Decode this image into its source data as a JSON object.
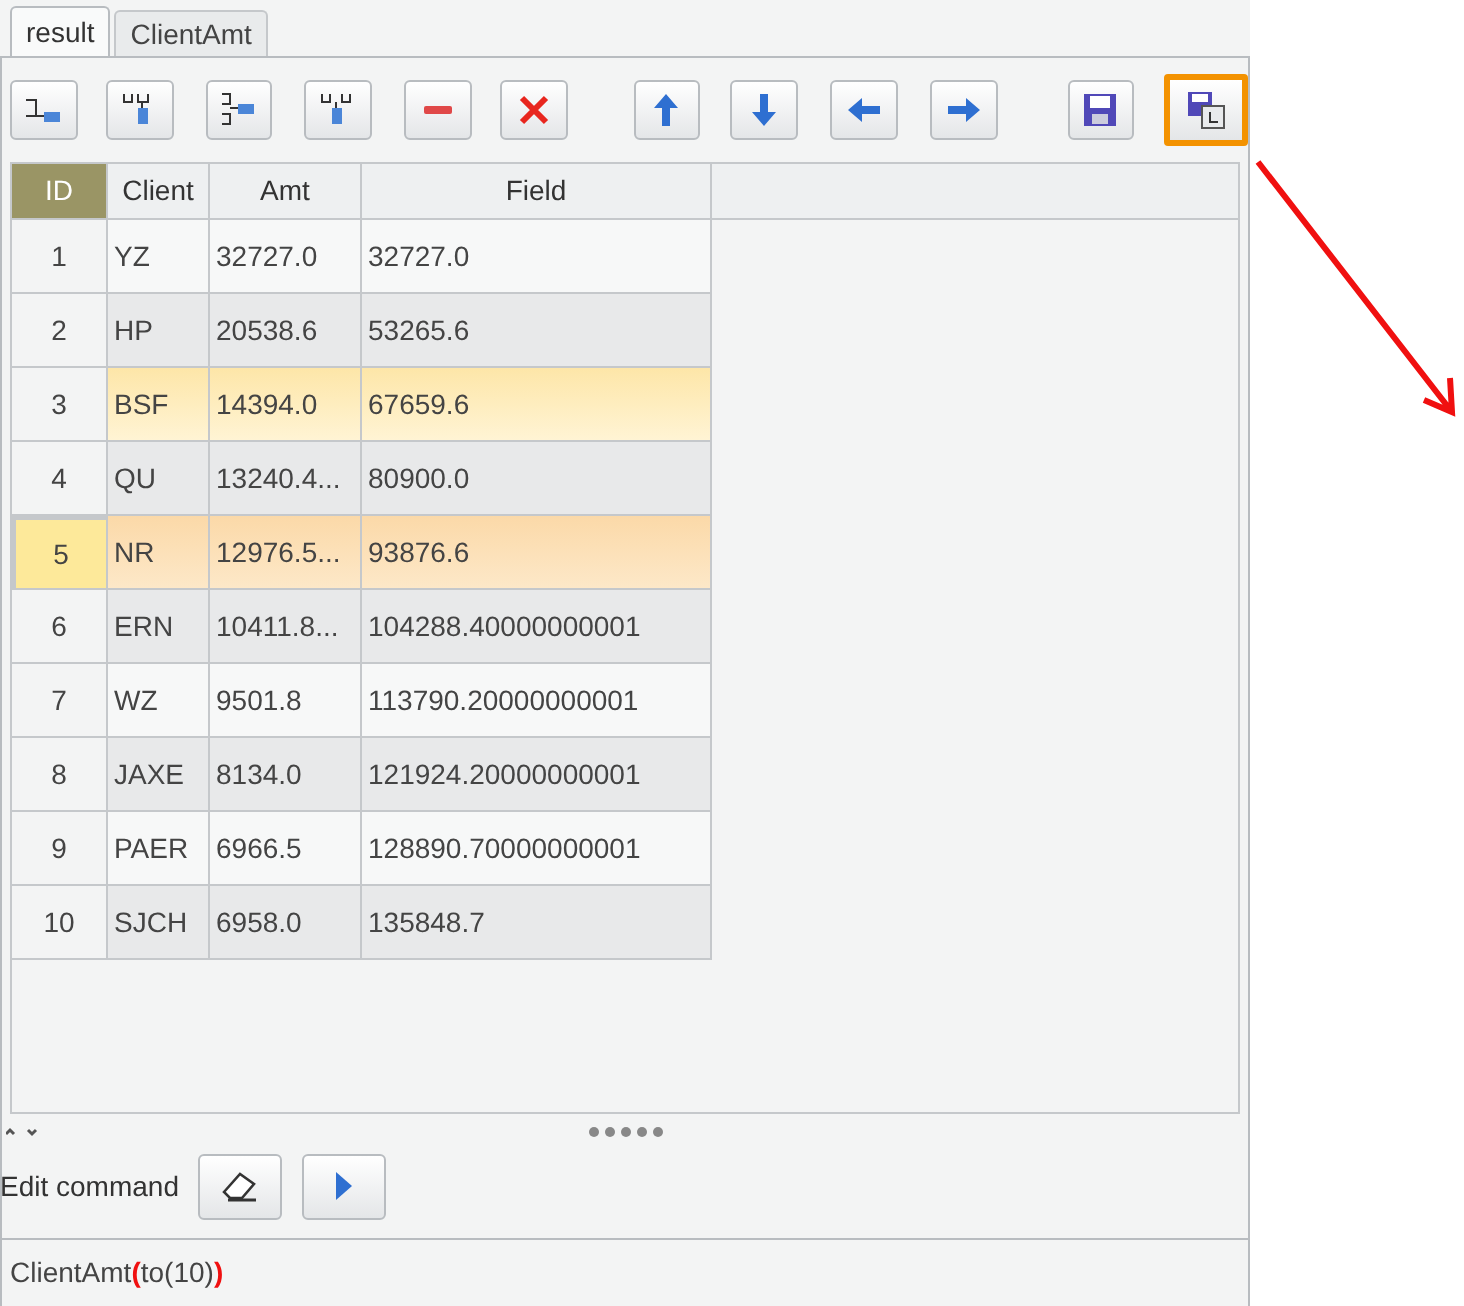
{
  "tabs": [
    {
      "label": "result",
      "selected": true
    },
    {
      "label": "ClientAmt",
      "selected": false
    }
  ],
  "toolbar": [
    {
      "kind": "insert-row",
      "highlighted": false
    },
    {
      "kind": "insert-col",
      "highlighted": false
    },
    {
      "kind": "add-row",
      "highlighted": false
    },
    {
      "kind": "add-col",
      "highlighted": false
    },
    {
      "kind": "delete",
      "highlighted": false
    },
    {
      "kind": "clear",
      "highlighted": false
    },
    {
      "kind": "up",
      "highlighted": false
    },
    {
      "kind": "down",
      "highlighted": false
    },
    {
      "kind": "left",
      "highlighted": false
    },
    {
      "kind": "right",
      "highlighted": false
    },
    {
      "kind": "save",
      "highlighted": false
    },
    {
      "kind": "save-as",
      "highlighted": true
    }
  ],
  "table": {
    "columns": [
      "ID",
      "Client",
      "Amt",
      "Field"
    ],
    "rows": [
      {
        "cells": [
          "1",
          "YZ",
          "32727.0",
          "32727.0"
        ],
        "highlighted": false,
        "selected": false
      },
      {
        "cells": [
          "2",
          "HP",
          "20538.6",
          "53265.6"
        ],
        "highlighted": false,
        "selected": false
      },
      {
        "cells": [
          "3",
          "BSF",
          "14394.0",
          "67659.6"
        ],
        "highlighted": true,
        "selected": false
      },
      {
        "cells": [
          "4",
          "QU",
          "13240.4...",
          "80900.0"
        ],
        "highlighted": false,
        "selected": false
      },
      {
        "cells": [
          "5",
          "NR",
          "12976.5...",
          "93876.6"
        ],
        "highlighted": false,
        "selected": true
      },
      {
        "cells": [
          "6",
          "ERN",
          "10411.8...",
          "104288.40000000001"
        ],
        "highlighted": false,
        "selected": false
      },
      {
        "cells": [
          "7",
          "WZ",
          "9501.8",
          "113790.20000000001"
        ],
        "highlighted": false,
        "selected": false
      },
      {
        "cells": [
          "8",
          "JAXE",
          "8134.0",
          "121924.20000000001"
        ],
        "highlighted": false,
        "selected": false
      },
      {
        "cells": [
          "9",
          "PAER",
          "6966.5",
          "128890.70000000001"
        ],
        "highlighted": false,
        "selected": false
      },
      {
        "cells": [
          "10",
          "SJCH",
          "6958.0",
          "135848.7"
        ],
        "highlighted": false,
        "selected": false
      }
    ]
  },
  "command": {
    "label": "Edit command",
    "text": [
      {
        "text": "ClientAmt",
        "kind": "plain"
      },
      {
        "text": "(",
        "kind": "bracket"
      },
      {
        "text": "to(10)",
        "kind": "plain"
      },
      {
        "text": ")",
        "kind": "bracket"
      }
    ]
  }
}
